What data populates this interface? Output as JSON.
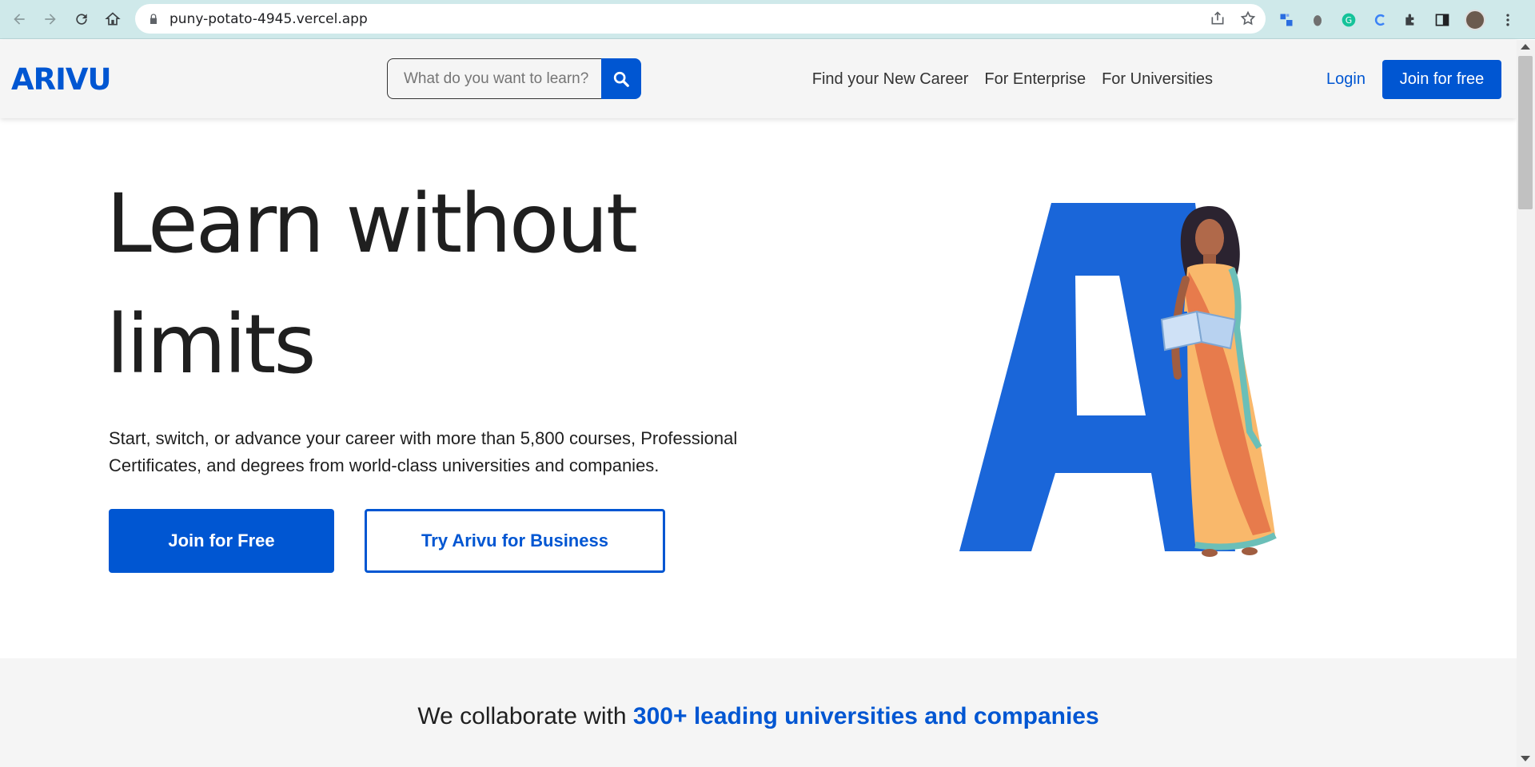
{
  "browser": {
    "url": "puny-potato-4945.vercel.app"
  },
  "header": {
    "logo": "ARIVU",
    "search_placeholder": "What do you want to learn?",
    "nav": [
      "Find your New Career",
      "For Enterprise",
      "For Universities"
    ],
    "login": "Login",
    "join": "Join for free"
  },
  "hero": {
    "title_line1": "Learn without",
    "title_line2": "limits",
    "subtitle": "Start, switch, or advance your career with more than 5,800 courses, Professional Certificates, and degrees from world-class universities and companies.",
    "primary_button": "Join for Free",
    "secondary_button": "Try Arivu for Business",
    "illustration_letter": "A"
  },
  "collab": {
    "prefix": "We collaborate with ",
    "highlight": "300+ leading universities and companies"
  },
  "colors": {
    "brand": "#0056d2",
    "illustration_blue": "#1a66d9"
  }
}
